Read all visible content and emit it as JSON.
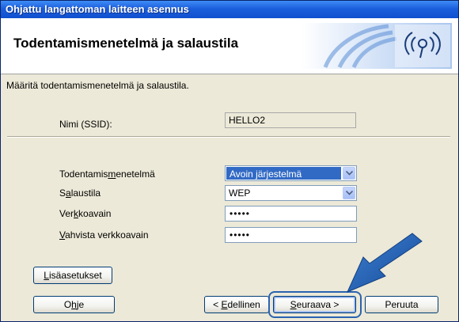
{
  "window": {
    "title": "Ohjattu langattoman laitteen asennus"
  },
  "header": {
    "title": "Todentamismenetelmä ja salaustila",
    "icon": "wifi-icon"
  },
  "instruction": "Määritä todentamismenetelmä ja salaustila.",
  "ssid": {
    "label": "Nimi (SSID):",
    "value": "HELLO2"
  },
  "fields": {
    "auth": {
      "label_pre": "Todentamis",
      "label_key": "m",
      "label_post": "enetelmä",
      "value": "Avoin järjestelmä"
    },
    "encryption": {
      "label_pre": "S",
      "label_key": "a",
      "label_post": "laustila",
      "value": "WEP"
    },
    "key": {
      "label_pre": "Ver",
      "label_key": "k",
      "label_post": "koavain",
      "value": "•••••"
    },
    "confirm": {
      "label_pre": "",
      "label_key": "V",
      "label_post": "ahvista verkkoavain",
      "value": "•••••"
    }
  },
  "buttons": {
    "advanced": {
      "pre": "",
      "key": "L",
      "post": "isäasetukset"
    },
    "help": {
      "pre": "O",
      "key": "h",
      "post": "je"
    },
    "back": {
      "pre": "< ",
      "key": "E",
      "post": "dellinen"
    },
    "next": {
      "pre": "",
      "key": "S",
      "post": "euraava >"
    },
    "cancel": {
      "label": "Peruuta"
    }
  },
  "colors": {
    "titlebar": "#1c5fdc",
    "highlight": "#316ac5",
    "pointer_arrow": "#1f5fae",
    "focus_ring": "#2a63b0"
  }
}
